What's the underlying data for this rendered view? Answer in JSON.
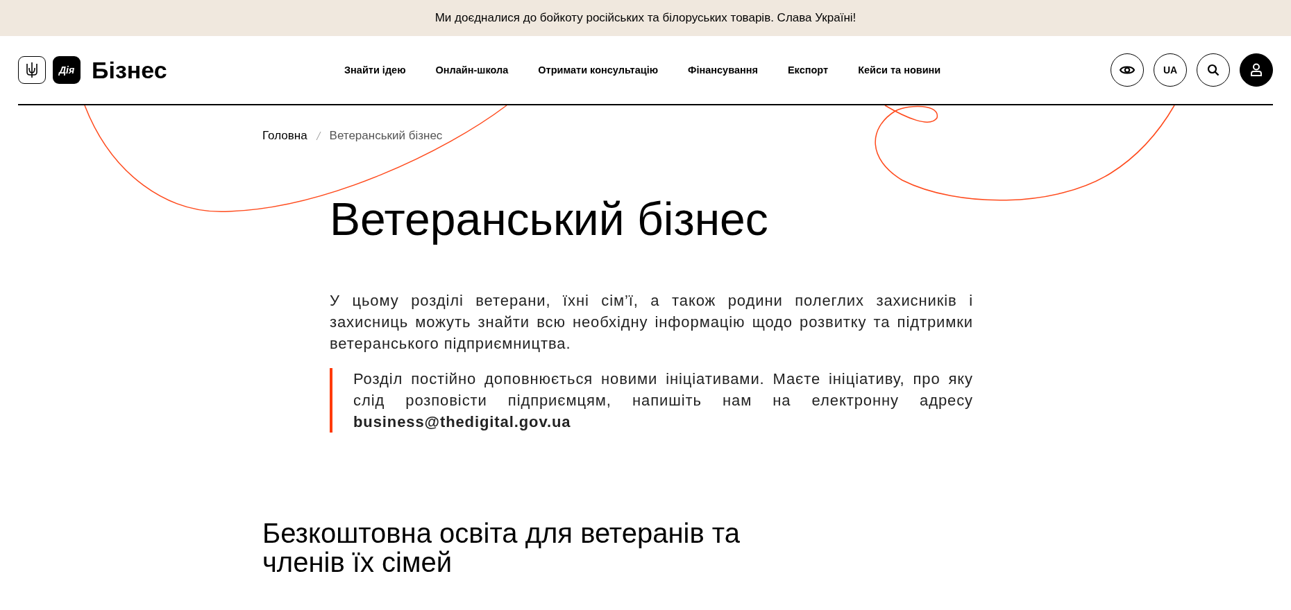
{
  "announcement": "Ми доєдналися до бойкоту російських та білоруських товарів. Слава Україні!",
  "header": {
    "logo_badge": "Дія",
    "logo_text": "Бізнес",
    "nav": [
      {
        "label": "Знайти ідею"
      },
      {
        "label": "Онлайн-школа"
      },
      {
        "label": "Отримати консультацію"
      },
      {
        "label": "Фінансування"
      },
      {
        "label": "Експорт"
      },
      {
        "label": "Кейси та новини"
      }
    ],
    "actions": [
      {
        "kind": "eye"
      },
      {
        "kind": "lang",
        "label": "UA"
      },
      {
        "kind": "search"
      },
      {
        "kind": "user"
      }
    ]
  },
  "breadcrumbs": [
    "Головна",
    "Ветеранський бізнес"
  ],
  "title": "Ветеранський бізнес",
  "intro": "У цьому розділі ветерани, їхні сім’ї, а також родини полеглих захисників і захисниць можуть знайти всю необхідну інформацію щодо розвитку та підтримки ветеранського підприємництва.",
  "note": "Розділ постійно доповнюється новими ініціативами. Маєте ініціативу, про яку слід розповісти підприємцям, напишіть нам на електронну адресу **business@thedigital.gov.ua**",
  "section_heading": "Безкоштовна освіта для ветеранів та членів їх сімей"
}
